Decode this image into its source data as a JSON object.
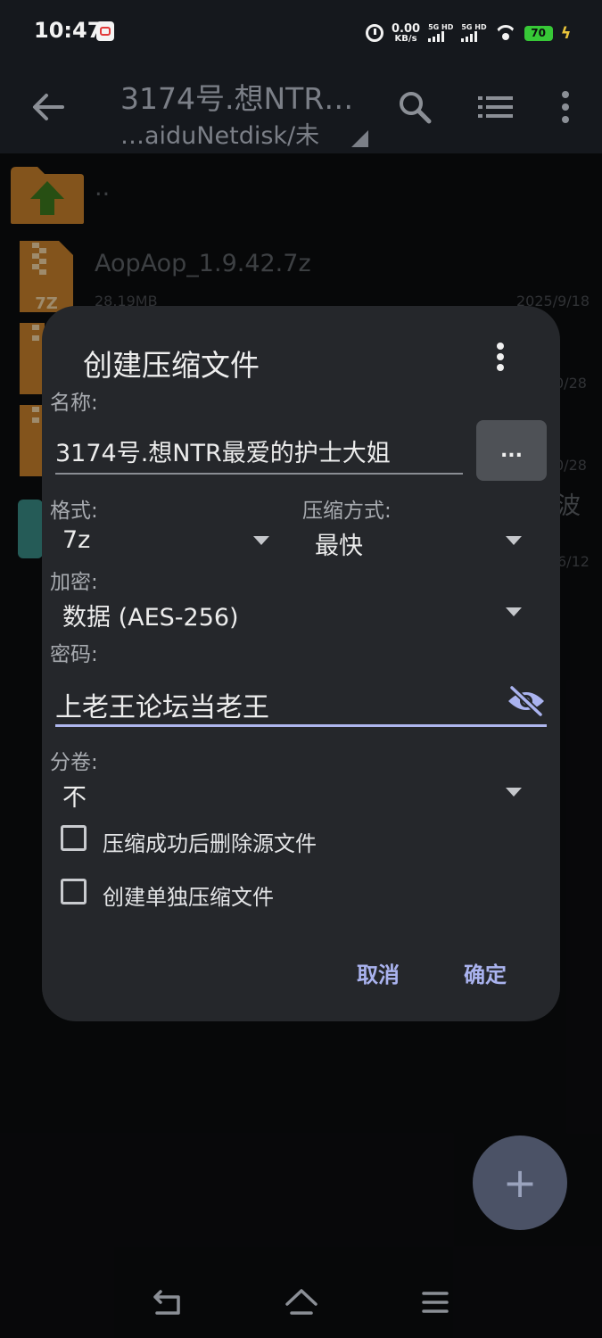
{
  "status": {
    "time": "10:47",
    "speed_value": "0.00",
    "speed_unit": "KB/s",
    "sim1": "5G HD",
    "sim2": "5G HD",
    "battery": "70"
  },
  "toolbar": {
    "title": "3174号.想NTR…",
    "subtitle": "…aiduNetdisk/未"
  },
  "files": [
    {
      "name": "..",
      "meta": "",
      "date": ""
    },
    {
      "name": "AopAop_1.9.42.7z",
      "meta": "28.19MB",
      "date": "2025/9/18"
    },
    {
      "name": "",
      "meta": "",
      "date": "0/28"
    },
    {
      "name": "",
      "meta": "",
      "date": "0/28"
    },
    {
      "name": "波",
      "meta": "",
      "date": "6/12"
    }
  ],
  "icons": {
    "zip_label": "7Z"
  },
  "dialog": {
    "title": "创建压缩文件",
    "name_label": "名称:",
    "name_value": "3174号.想NTR最爱的护士大姐",
    "browse_label": "...",
    "format_label": "格式:",
    "format_value": "7z",
    "method_label": "压缩方式:",
    "method_value": "最快",
    "encrypt_label": "加密:",
    "encrypt_value": "数据 (AES-256)",
    "password_label": "密码:",
    "password_value": "上老王论坛当老王",
    "volume_label": "分卷:",
    "volume_value": "不",
    "option_delete_source": "压缩成功后删除源文件",
    "option_separate": "创建单独压缩文件",
    "cancel": "取消",
    "confirm": "确定"
  },
  "fab_label": "+",
  "colors": {
    "accent": "#aab3ef",
    "dialog_bg": "#25272b",
    "folder": "#c9822c",
    "up_arrow": "#3d7a1e",
    "fab": "#4b5266"
  }
}
